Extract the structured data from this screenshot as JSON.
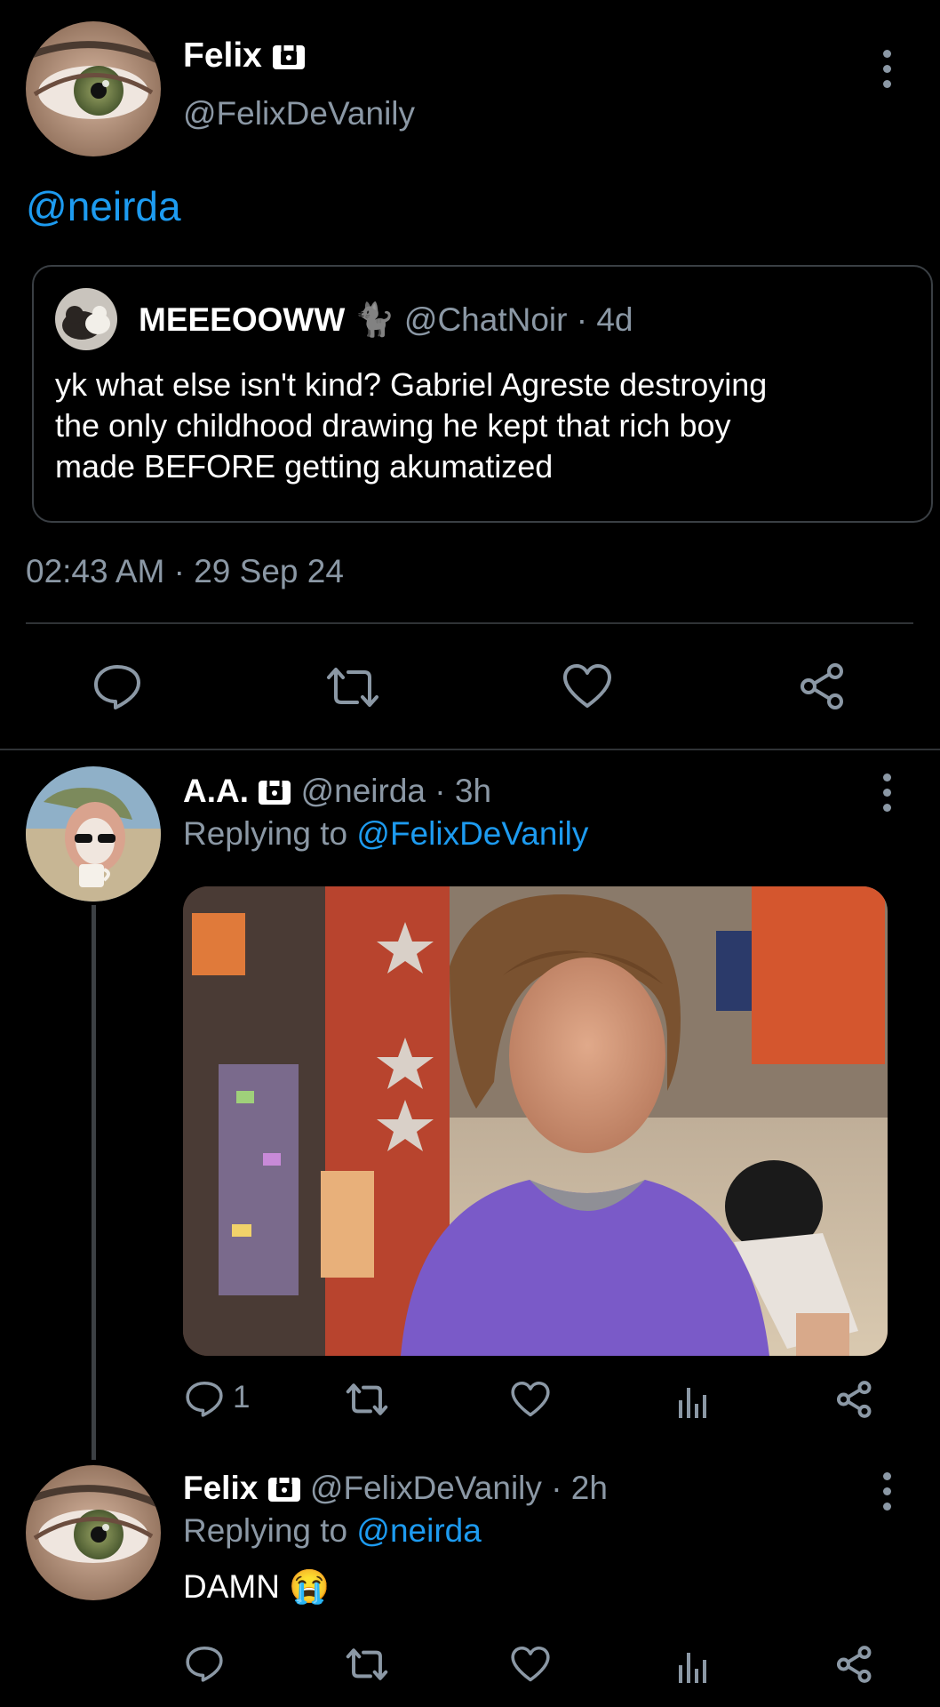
{
  "colors": {
    "background": "#000000",
    "accent": "#1d9bf0",
    "muted": "#8b98a5",
    "divider": "#2f3336"
  },
  "main_tweet": {
    "author_name": "Felix",
    "author_handle": "@FelixDeVanily",
    "text_mention": "@neirda",
    "quoted": {
      "author_name": "MEEEOOWW",
      "author_emoji": "🐈",
      "author_handle": "@ChatNoir",
      "time": "· 4d",
      "lines": [
        "yk what else isn't kind? Gabriel Agreste destroying",
        "the only childhood drawing  he kept that rich boy",
        "made BEFORE getting akumatized"
      ]
    },
    "timestamp": "02:43 AM · 29 Sep 24",
    "actions": [
      "reply-icon",
      "retweet-icon",
      "like-icon",
      "share-icon"
    ]
  },
  "reply1": {
    "author_name": "A.A.",
    "author_handle": "@neirda",
    "time": "· 3h",
    "replying_prefix": "Replying to",
    "replying_to": "@FelixDeVanily",
    "reply_count": "1",
    "actions": [
      "reply-icon",
      "retweet-icon",
      "like-icon",
      "views-icon",
      "share-icon"
    ]
  },
  "reply2": {
    "author_name": "Felix",
    "author_handle": "@FelixDeVanily",
    "time": "· 2h",
    "replying_prefix": "Replying to",
    "replying_to": "@neirda",
    "text": "DAMN",
    "emoji": "😭",
    "actions": [
      "reply-icon",
      "retweet-icon",
      "like-icon",
      "views-icon",
      "share-icon"
    ]
  }
}
